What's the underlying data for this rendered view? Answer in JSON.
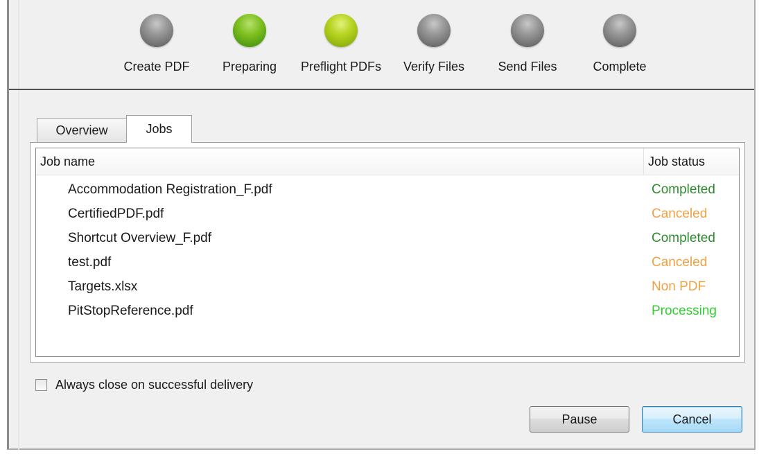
{
  "steps": [
    {
      "label": "Create PDF",
      "state": "gray"
    },
    {
      "label": "Preparing",
      "state": "green"
    },
    {
      "label": "Preflight PDFs",
      "state": "lime"
    },
    {
      "label": "Verify Files",
      "state": "gray"
    },
    {
      "label": "Send Files",
      "state": "gray"
    },
    {
      "label": "Complete",
      "state": "gray"
    }
  ],
  "tabs": [
    {
      "label": "Overview",
      "active": false
    },
    {
      "label": "Jobs",
      "active": true
    }
  ],
  "columns": {
    "name": "Job name",
    "status": "Job status"
  },
  "jobs": [
    {
      "name": "Accommodation Registration_F.pdf",
      "status": "Completed",
      "color": "#2e8b2e"
    },
    {
      "name": "CertifiedPDF.pdf",
      "status": "Canceled",
      "color": "#f0a040"
    },
    {
      "name": "Shortcut Overview_F.pdf",
      "status": "Completed",
      "color": "#2e8b2e"
    },
    {
      "name": "test.pdf",
      "status": "Canceled",
      "color": "#f0a040"
    },
    {
      "name": "Targets.xlsx",
      "status": "Non PDF",
      "color": "#f0a040"
    },
    {
      "name": "PitStopReference.pdf",
      "status": "Processing",
      "color": "#33cc33"
    }
  ],
  "always_close_label": "Always close on successful delivery",
  "buttons": {
    "pause": "Pause",
    "cancel": "Cancel"
  }
}
